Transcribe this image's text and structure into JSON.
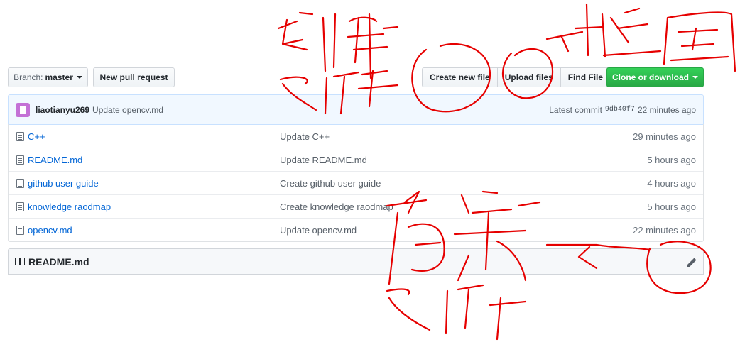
{
  "toolbar": {
    "branch_prefix": "Branch:",
    "branch_name": "master",
    "new_pull_request": "New pull request",
    "create_new_file": "Create new file",
    "upload_files": "Upload files",
    "find_file": "Find File",
    "clone_or_download": "Clone or download"
  },
  "commit": {
    "author": "liaotianyu269",
    "message": "Update opencv.md",
    "latest_label": "Latest commit",
    "sha": "9db40f7",
    "time": "22 minutes ago"
  },
  "files": [
    {
      "name": "C++",
      "message": "Update C++",
      "age": "29 minutes ago"
    },
    {
      "name": "README.md",
      "message": "Update README.md",
      "age": "5 hours ago"
    },
    {
      "name": "github user guide",
      "message": "Create github user guide",
      "age": "4 hours ago"
    },
    {
      "name": "knowledge raodmap",
      "message": "Create knowledge raodmap",
      "age": "5 hours ago"
    },
    {
      "name": "opencv.md",
      "message": "Update opencv.md",
      "age": "22 minutes ago"
    }
  ],
  "readme": {
    "title": "README.md"
  },
  "colors": {
    "link": "#0366d6",
    "clone_button": "#28a745",
    "annotation": "#e60000"
  },
  "icons": [
    "caret-down-icon",
    "file-icon",
    "book-icon",
    "pencil-icon"
  ]
}
